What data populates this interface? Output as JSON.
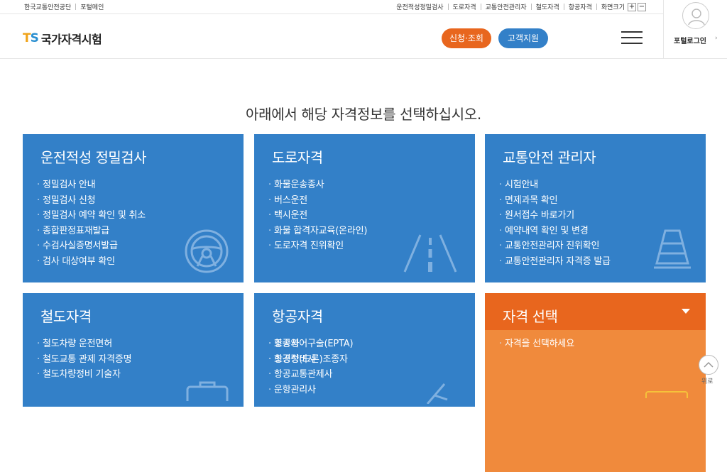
{
  "topbar": {
    "left": [
      "한국교통안전공단",
      "포털메인"
    ],
    "right": [
      "운전적성정밀검사",
      "도로자격",
      "교통안전관리자",
      "철도자격",
      "항공자격",
      "화면크기"
    ],
    "zoom_plus": "+",
    "zoom_minus": "−"
  },
  "header": {
    "logo_t": "T",
    "logo_s": "S",
    "logo_name": "국가자격시험",
    "btn_apply": "신청·조회",
    "btn_support": "고객지원",
    "login": "포털로그인",
    "login_arrow": "›"
  },
  "headline": "아래에서 해당 자격정보를 선택하십시오.",
  "cards": [
    {
      "title": "운전적성 정밀검사",
      "items": [
        "정밀검사 안내",
        "정밀검사 신청",
        "정밀검사 예약 확인 및 취소",
        "종합판정표재발급",
        "수검사실증명서발급",
        "검사 대상여부 확인"
      ]
    },
    {
      "title": "도로자격",
      "items": [
        "화물운송종사",
        "버스운전",
        "택시운전",
        "화물 합격자교육(온라인)",
        "도로자격 진위확인"
      ]
    },
    {
      "title": "교통안전 관리자",
      "items": [
        "시험안내",
        "면제과목 확인",
        "원서접수 바로가기",
        "예약내역 확인 및 변경",
        "교통안전관리자 진위확인",
        "교통안전관리자 자격증 발급"
      ]
    },
    {
      "title": "철도자격",
      "items": [
        "철도차량 운전면허",
        "철도교통 관제 자격증명",
        "철도차량정비 기술자"
      ]
    },
    {
      "title": "항공자격",
      "items_col1": [
        "조종사",
        "항공정비사",
        "항공교통관제사",
        "운항관리사"
      ],
      "items_col2": [
        "항공영어구술(EPTA)",
        "초경량(드론)조종자"
      ]
    },
    {
      "title": "자격 선택",
      "items": [
        "자격을 선택하세요"
      ]
    }
  ],
  "totop_label": "위로",
  "colors": {
    "blue": "#3380c8",
    "orange": "#e8661e"
  }
}
